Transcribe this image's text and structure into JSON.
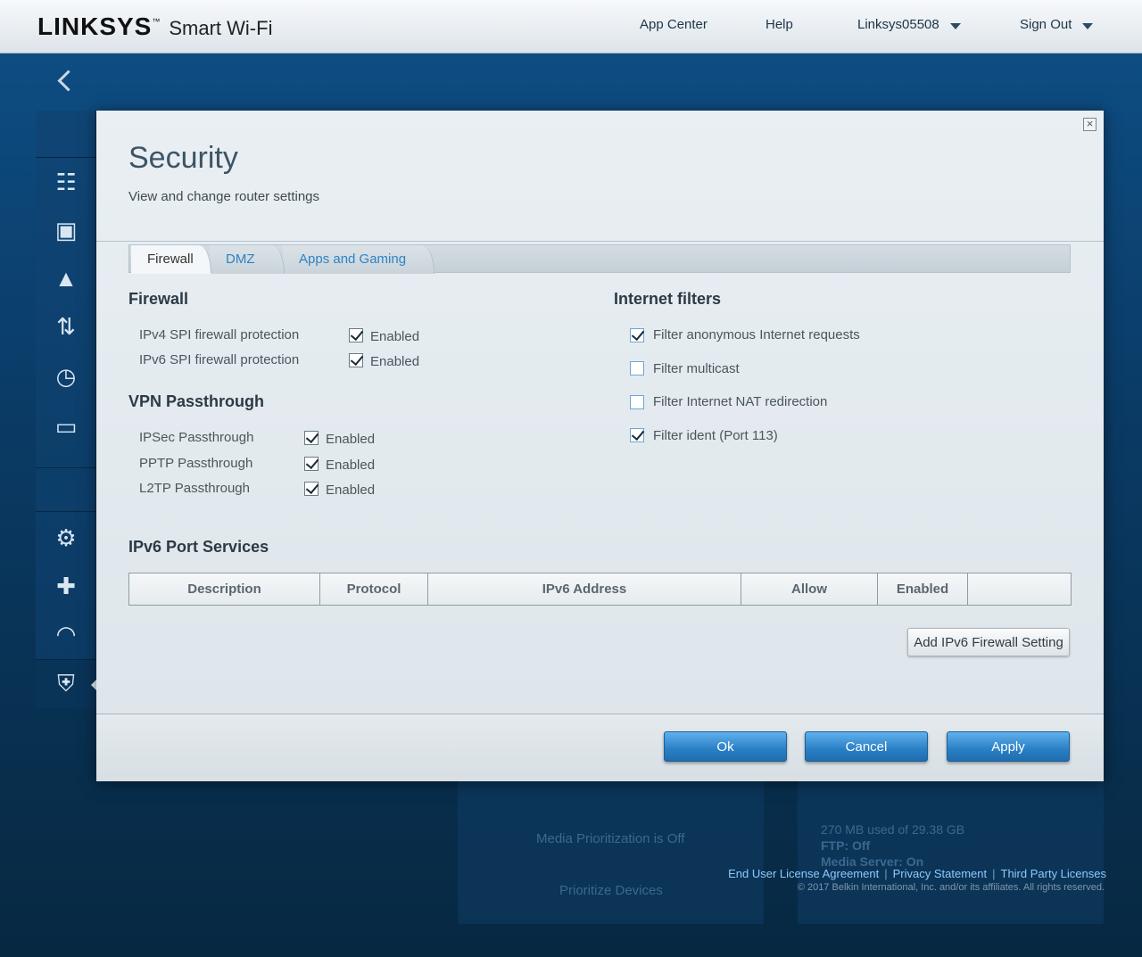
{
  "header": {
    "brand": "LINKSYS",
    "trademark": "™",
    "product": "Smart Wi-Fi",
    "nav": {
      "app_center": "App Center",
      "help": "Help",
      "account": "Linksys05508",
      "sign_out": "Sign Out"
    }
  },
  "sidebar": {
    "items": [
      {
        "name": "network-map-icon",
        "glyph": "☷"
      },
      {
        "name": "guest-access-icon",
        "glyph": "▣"
      },
      {
        "name": "parental-controls-icon",
        "glyph": "▲"
      },
      {
        "name": "media-prioritization-icon",
        "glyph": "⇅"
      },
      {
        "name": "speed-test-icon",
        "glyph": "◷"
      },
      {
        "name": "external-storage-icon",
        "glyph": "▭"
      },
      {
        "name": "connectivity-icon",
        "glyph": "⚙"
      },
      {
        "name": "troubleshooting-icon",
        "glyph": "✚"
      },
      {
        "name": "wireless-icon",
        "glyph": "◠"
      },
      {
        "name": "security-icon",
        "glyph": "⛨"
      }
    ]
  },
  "background": {
    "text_a": "Media Prioritization is Off",
    "text_b": "Prioritize Devices",
    "text_c": "270 MB used of 29.38 GB",
    "text_d": "FTP: Off",
    "text_e": "Media Server: On"
  },
  "footer": {
    "eula": "End User License Agreement",
    "privacy": "Privacy Statement",
    "third_party": "Third Party Licenses",
    "copyright": "© 2017 Belkin International, Inc. and/or its affiliates. All rights reserved.",
    "separator": "|"
  },
  "modal": {
    "close": "×",
    "title": "Security",
    "subtitle": "View and change router settings",
    "tabs": [
      {
        "label": "Firewall",
        "active": true
      },
      {
        "label": "DMZ",
        "active": false
      },
      {
        "label": "Apps and Gaming",
        "active": false
      }
    ],
    "firewall": {
      "heading": "Firewall",
      "rows": [
        {
          "label": "IPv4 SPI firewall protection",
          "checkbox_label": "Enabled",
          "checked": true
        },
        {
          "label": "IPv6 SPI firewall protection",
          "checkbox_label": "Enabled",
          "checked": true
        }
      ]
    },
    "vpn": {
      "heading": "VPN Passthrough",
      "rows": [
        {
          "label": "IPSec Passthrough",
          "checkbox_label": "Enabled",
          "checked": true
        },
        {
          "label": "PPTP Passthrough",
          "checkbox_label": "Enabled",
          "checked": true
        },
        {
          "label": "L2TP Passthrough",
          "checkbox_label": "Enabled",
          "checked": true
        }
      ]
    },
    "internet_filters": {
      "heading": "Internet filters",
      "items": [
        {
          "label": "Filter anonymous Internet requests",
          "checked": true
        },
        {
          "label": "Filter multicast",
          "checked": false
        },
        {
          "label": "Filter Internet NAT redirection",
          "checked": false
        },
        {
          "label": "Filter ident (Port 113)",
          "checked": true
        }
      ]
    },
    "ipv6": {
      "heading": "IPv6 Port Services",
      "columns": [
        "Description",
        "Protocol",
        "IPv6 Address",
        "Allow",
        "Enabled",
        ""
      ],
      "add_button": "Add IPv6 Firewall Setting"
    },
    "buttons": {
      "ok": "Ok",
      "cancel": "Cancel",
      "apply": "Apply"
    }
  }
}
